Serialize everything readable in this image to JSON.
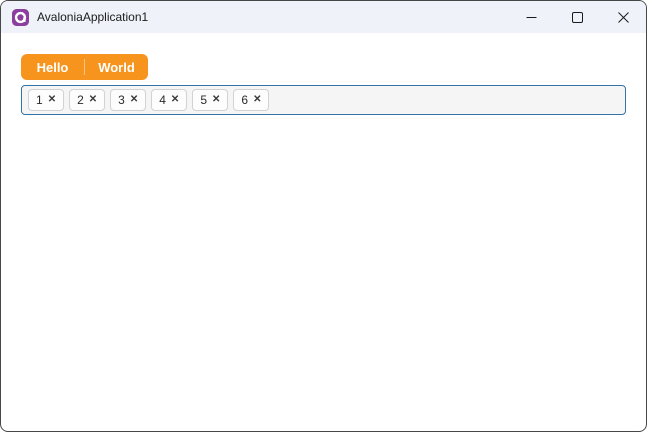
{
  "window": {
    "title": "AvaloniaApplication1",
    "icons": {
      "app": "avalonia-logo",
      "minimize": "minimize-icon",
      "maximize": "maximize-icon",
      "close": "close-icon"
    }
  },
  "tabs": [
    {
      "label": "Hello"
    },
    {
      "label": "World"
    }
  ],
  "tag_box": {
    "items": [
      {
        "label": "1"
      },
      {
        "label": "2"
      },
      {
        "label": "3"
      },
      {
        "label": "4"
      },
      {
        "label": "5"
      },
      {
        "label": "6"
      }
    ],
    "remove_glyph": "✕"
  },
  "colors": {
    "accent_orange": "#F7941E",
    "focus_border_blue": "#3273A8",
    "titlebar_bg": "#EFF3F9",
    "logo_purple": "#8B3E9E"
  }
}
